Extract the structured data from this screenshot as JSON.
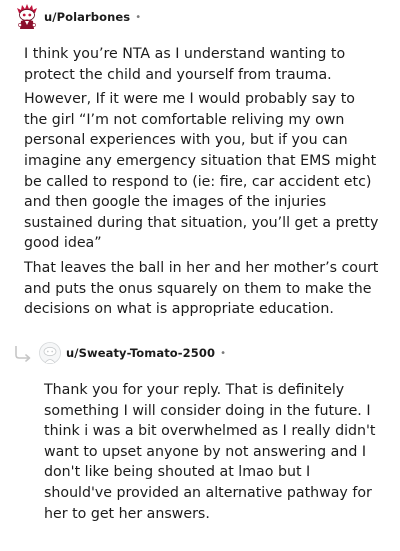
{
  "comments": [
    {
      "author": "u/Polarbones",
      "separator": "•",
      "avatar_icon": "red-snoo-avatar-icon",
      "paragraphs": [
        "I think you’re NTA as I understand wanting to protect the child and yourself from trauma.",
        "However, If it were me I would probably say to the girl “I’m not comfortable reliving my own personal experiences with you, but if you can imagine any emergency situation that EMS might be called to respond to (ie: fire, car accident etc) and then google the images of the injuries sustained during that situation, you’ll get a pretty good idea”",
        "That leaves the ball in her and her mother’s court and puts the onus squarely on them to make the decisions on what is appropriate education."
      ]
    },
    {
      "author": "u/Sweaty-Tomato-2500",
      "separator": "•",
      "avatar_icon": "default-grey-avatar-icon",
      "reply_icon": "reply-hook-icon",
      "paragraphs": [
        "Thank you for your reply. That is definitely something I will consider doing in the future. I think i was a bit overwhelmed as I really didn't want to upset anyone by not answering and I don't like being shouted at lmao but I should've provided an alternative pathway for her to get her answers."
      ]
    }
  ]
}
